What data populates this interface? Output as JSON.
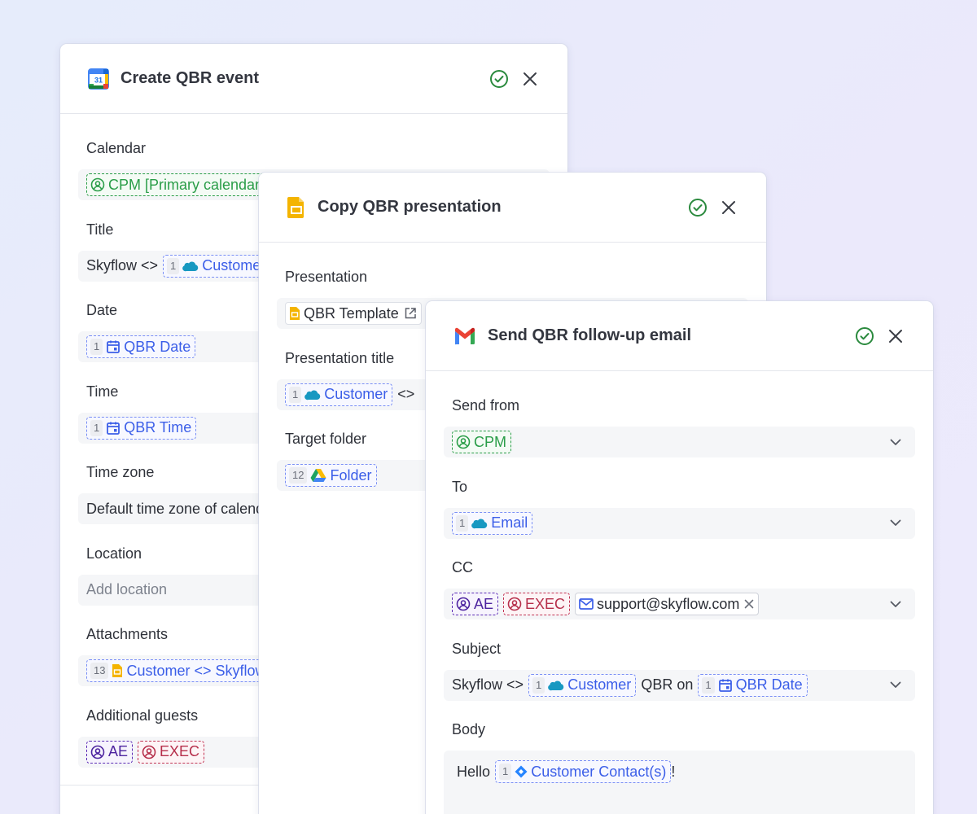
{
  "card1": {
    "title": "Create QBR event",
    "fields": {
      "calendar": {
        "label": "Calendar",
        "token": "CPM [Primary calendar]"
      },
      "title": {
        "label": "Title",
        "prefix": "Skyflow <>",
        "token_num": "1",
        "token": "Customer"
      },
      "date": {
        "label": "Date",
        "token_num": "1",
        "token": "QBR Date"
      },
      "time": {
        "label": "Time",
        "token_num": "1",
        "token": "QBR Time"
      },
      "timezone": {
        "label": "Time zone",
        "value": "Default time zone of calendar"
      },
      "location": {
        "label": "Location",
        "placeholder": "Add location"
      },
      "attachments": {
        "label": "Attachments",
        "token_num": "13",
        "token": "Customer <> Skyflow QBR"
      },
      "guests": {
        "label": "Additional guests",
        "token_a": "AE",
        "token_b": "EXEC"
      }
    }
  },
  "card2": {
    "title": "Copy QBR presentation",
    "fields": {
      "presentation": {
        "label": "Presentation",
        "token": "QBR Template"
      },
      "pres_title": {
        "label": "Presentation title",
        "token_num": "1",
        "token": "Customer",
        "suffix": "<>"
      },
      "folder": {
        "label": "Target folder",
        "token_num": "12",
        "token": "Folder"
      }
    }
  },
  "card3": {
    "title": "Send QBR follow-up email",
    "fields": {
      "from": {
        "label": "Send from",
        "token": "CPM"
      },
      "to": {
        "label": "To",
        "token_num": "1",
        "token": "Email"
      },
      "cc": {
        "label": "CC",
        "token_a": "AE",
        "token_b": "EXEC",
        "email": "support@skyflow.com"
      },
      "subject": {
        "label": "Subject",
        "prefix": "Skyflow <>",
        "token_num": "1",
        "token": "Customer",
        "middle": "QBR on",
        "token2_num": "1",
        "token2": "QBR Date"
      },
      "body": {
        "label": "Body",
        "prefix": "Hello",
        "token_num": "1",
        "token": "Customer Contact(s)",
        "suffix": "!"
      }
    }
  },
  "colors": {
    "token_blue": "#3b5ee8",
    "green": "#2a9d48",
    "purple": "#4d249f",
    "red": "#b62f4b",
    "check": "#2b8a3e"
  },
  "icons": [
    "google-calendar-icon",
    "google-slides-icon",
    "gmail-icon",
    "check-circle-icon",
    "close-icon",
    "salesforce-cloud-icon",
    "calendar-event-icon",
    "user-circle-icon",
    "external-link-icon",
    "google-drive-icon",
    "mail-icon",
    "chevron-down-icon",
    "jira-diamond-icon"
  ]
}
